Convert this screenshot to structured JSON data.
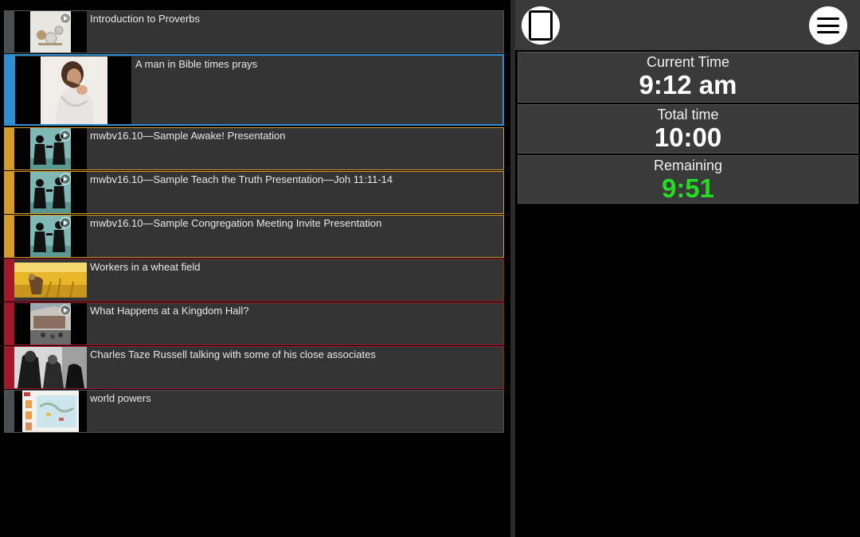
{
  "media_items": [
    {
      "title": "Introduction to Proverbs",
      "stripe_color": "#4a4e52",
      "play": true,
      "thumb": "proverbs"
    },
    {
      "title": "A man in Bible times prays",
      "stripe_color": "#2f8fd2",
      "play": false,
      "thumb": "praying-man"
    },
    {
      "title": "mwbv16.10—Sample Awake! Presentation",
      "stripe_color": "#d49a2a",
      "play": true,
      "thumb": "silhouette"
    },
    {
      "title": "mwbv16.10—Sample Teach the Truth Presentation—Joh 11:11-14",
      "stripe_color": "#d49a2a",
      "play": true,
      "thumb": "silhouette"
    },
    {
      "title": "mwbv16.10—Sample Congregation Meeting Invite Presentation",
      "stripe_color": "#d49a2a",
      "play": true,
      "thumb": "silhouette"
    },
    {
      "title": "Workers in a wheat field",
      "stripe_color": "#a01a2a",
      "play": false,
      "thumb": "wheat-field"
    },
    {
      "title": "What Happens at a Kingdom Hall?",
      "stripe_color": "#a01a2a",
      "play": true,
      "thumb": "kingdom-hall"
    },
    {
      "title": "Charles Taze Russell talking with some of his close associates",
      "stripe_color": "#a01a2a",
      "play": false,
      "thumb": "historic-photo"
    },
    {
      "title": "world powers",
      "stripe_color": "#4a4e52",
      "play": false,
      "thumb": "map-chart"
    }
  ],
  "selected_index": 1,
  "timer": {
    "current_time_label": "Current Time",
    "current_time_value": "9:12 am",
    "total_time_label": "Total time",
    "total_time_value": "10:00",
    "remaining_label": "Remaining",
    "remaining_value": "9:51",
    "remaining_color": "#22dd22"
  },
  "icons": {
    "stop": "stop-icon",
    "menu": "menu-icon",
    "play": "play-icon"
  }
}
